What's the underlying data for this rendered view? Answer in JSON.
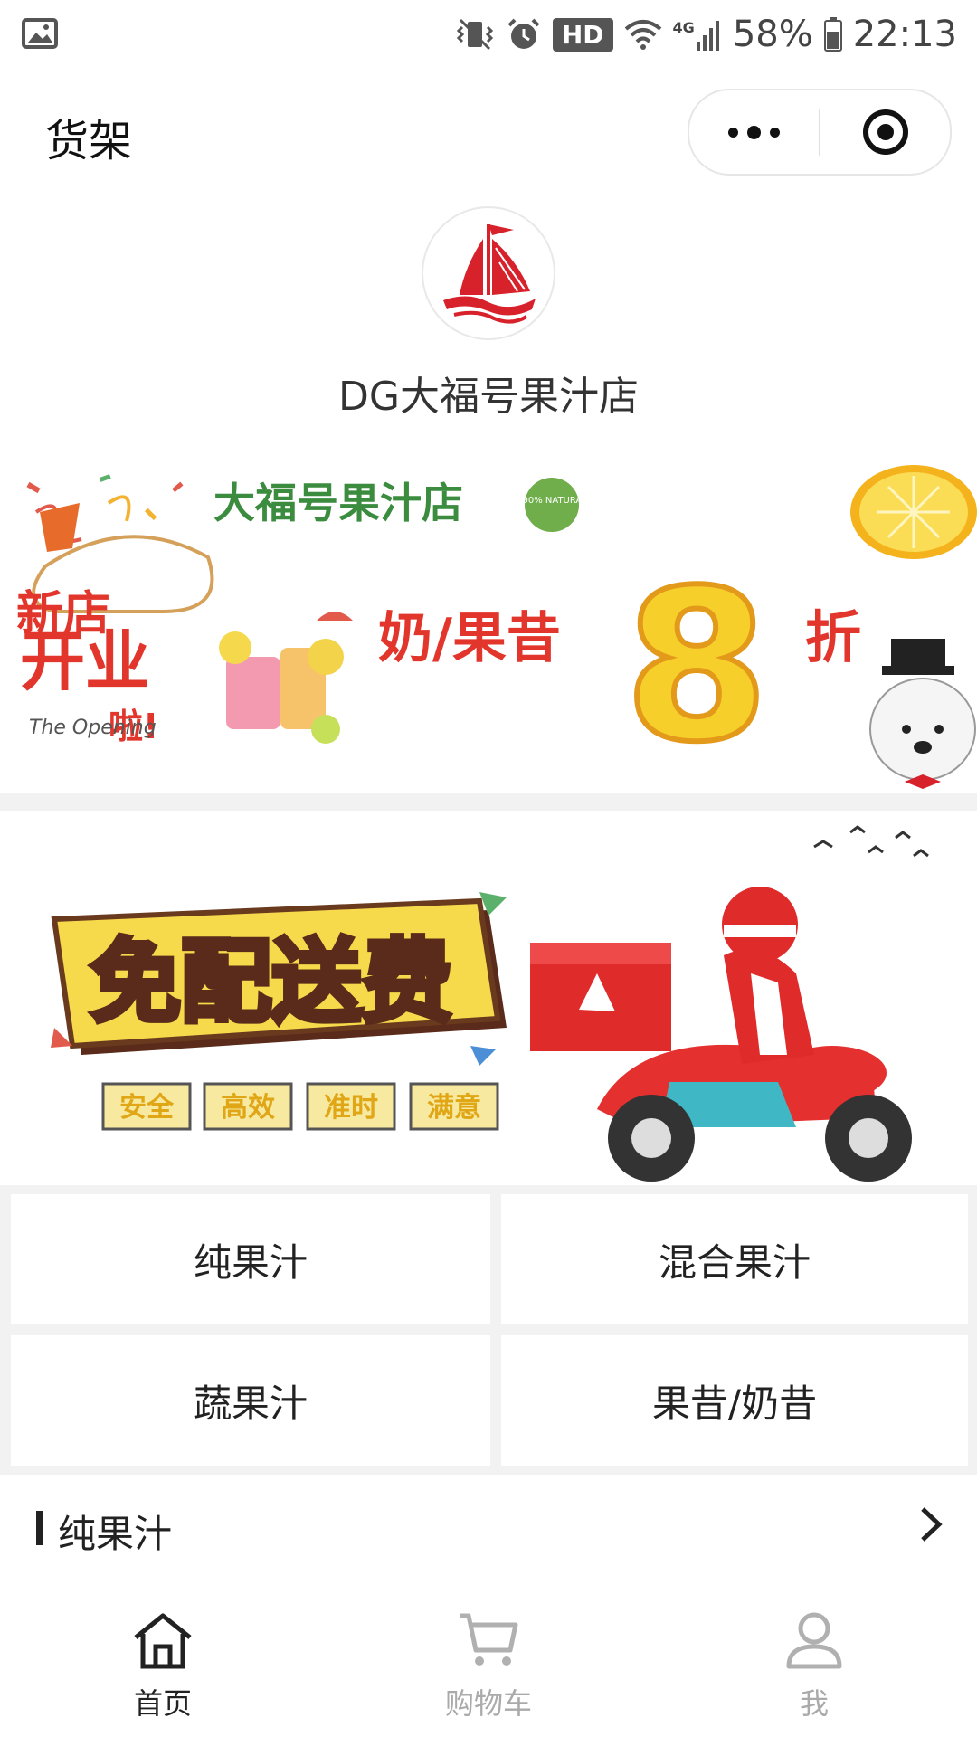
{
  "status_bar": {
    "hd": "HD",
    "network": "4G",
    "battery": "58%",
    "time": "22:13"
  },
  "nav": {
    "title": "货架"
  },
  "shop": {
    "name": "DG大福号果汁店"
  },
  "banner1": {
    "shop_name": "大福号果汁店",
    "badge": "100% NATURAL",
    "new_store": "新店",
    "open": "开业",
    "la": "啦!",
    "opening": "The Opening",
    "promo": "奶/果昔",
    "number": "8",
    "discount": "折"
  },
  "banner2": {
    "headline": "免配送费",
    "tags": [
      "安全",
      "高效",
      "准时",
      "满意"
    ]
  },
  "categories": [
    "纯果汁",
    "混合果汁",
    "蔬果汁",
    "果昔/奶昔"
  ],
  "section": {
    "title": "纯果汁"
  },
  "tabs": [
    {
      "label": "首页",
      "icon": "home-icon"
    },
    {
      "label": "购物车",
      "icon": "cart-icon"
    },
    {
      "label": "我",
      "icon": "user-icon"
    }
  ],
  "colors": {
    "accent_red": "#d8222b",
    "active_tab": "#222222",
    "inactive_tab": "#aaaaaa"
  }
}
